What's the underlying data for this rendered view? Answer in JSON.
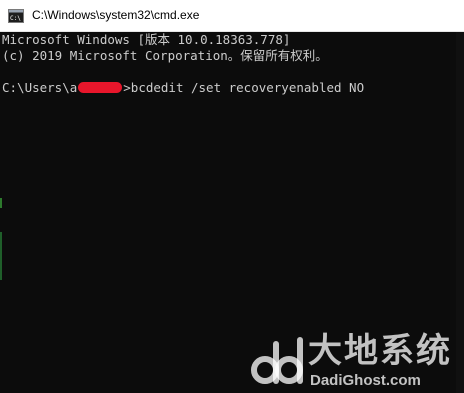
{
  "window": {
    "title": "C:\\Windows\\system32\\cmd.exe",
    "icon": "cmd-icon"
  },
  "console": {
    "lines": [
      "Microsoft Windows [版本 10.0.18363.778]",
      "(c) 2019 Microsoft Corporation。保留所有权利。"
    ],
    "prompt_prefix": "C:\\Users\\a",
    "prompt_suffix": ">",
    "command": "bcdedit /set recoveryenabled NO"
  },
  "watermark": {
    "cn_text": "大地系统",
    "en_text": "DadiGhost.com"
  },
  "colors": {
    "console_bg": "#0c0c0c",
    "console_text": "#cccccc",
    "redaction": "#e8162b"
  }
}
